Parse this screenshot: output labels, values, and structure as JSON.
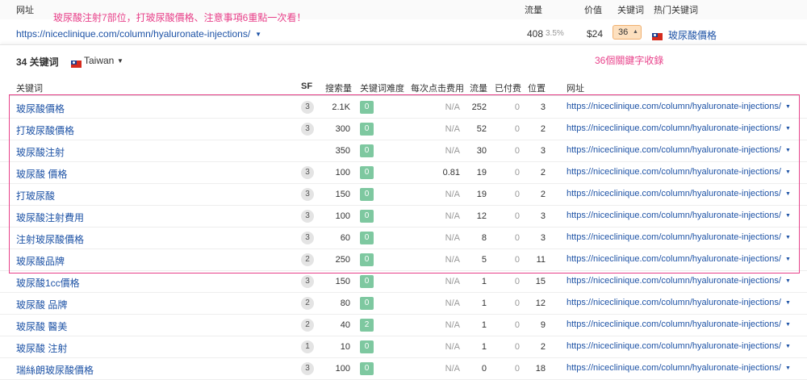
{
  "top_header": {
    "url_label": "网址",
    "traffic_label": "流量",
    "value_label": "价值",
    "keywords_label": "关键词",
    "top_keyword_label": "热门关键词"
  },
  "annotation_top": "玻尿酸注射7部位，打玻尿酸價格、注意事項6重點一次看！",
  "top_row": {
    "url": "https://niceclinique.com/column/hyaluronate-injections/",
    "traffic": "408",
    "traffic_pct": "3.5%",
    "value": "$24",
    "keywords": "36",
    "top_keyword": "玻尿酸價格",
    "top_keyword_flag": "taiwan-flag-icon"
  },
  "panel": {
    "count": "34 关键词",
    "country": "Taiwan",
    "annotation": "36個關鍵字收錄"
  },
  "columns": {
    "keyword": "关键词",
    "sf": "SF",
    "volume": "搜索量",
    "kd": "关键词难度",
    "cpc": "每次点击费用",
    "traffic": "流量",
    "paid": "已付费",
    "position": "位置",
    "url": "网址"
  },
  "colors": {
    "link": "#1e53a6",
    "annotation": "#e8418a",
    "kd_badge": "#7ec8a0",
    "sf_badge": "#e4e4e4",
    "keywords_chip": "#fde0bf"
  },
  "rows": [
    {
      "keyword": "玻尿酸價格",
      "sf": "3",
      "volume": "2.1K",
      "kd": "0",
      "cpc": "N/A",
      "traffic": "252",
      "paid": "0",
      "position": "3",
      "url": "https://niceclinique.com/column/hyaluronate-injections/"
    },
    {
      "keyword": "打玻尿酸價格",
      "sf": "3",
      "volume": "300",
      "kd": "0",
      "cpc": "N/A",
      "traffic": "52",
      "paid": "0",
      "position": "2",
      "url": "https://niceclinique.com/column/hyaluronate-injections/"
    },
    {
      "keyword": "玻尿酸注射",
      "sf": "",
      "volume": "350",
      "kd": "0",
      "cpc": "N/A",
      "traffic": "30",
      "paid": "0",
      "position": "3",
      "url": "https://niceclinique.com/column/hyaluronate-injections/"
    },
    {
      "keyword": "玻尿酸 價格",
      "sf": "3",
      "volume": "100",
      "kd": "0",
      "cpc": "0.81",
      "traffic": "19",
      "paid": "0",
      "position": "2",
      "url": "https://niceclinique.com/column/hyaluronate-injections/"
    },
    {
      "keyword": "打玻尿酸",
      "sf": "3",
      "volume": "150",
      "kd": "0",
      "cpc": "N/A",
      "traffic": "19",
      "paid": "0",
      "position": "2",
      "url": "https://niceclinique.com/column/hyaluronate-injections/"
    },
    {
      "keyword": "玻尿酸注射費用",
      "sf": "3",
      "volume": "100",
      "kd": "0",
      "cpc": "N/A",
      "traffic": "12",
      "paid": "0",
      "position": "3",
      "url": "https://niceclinique.com/column/hyaluronate-injections/"
    },
    {
      "keyword": "注射玻尿酸價格",
      "sf": "3",
      "volume": "60",
      "kd": "0",
      "cpc": "N/A",
      "traffic": "8",
      "paid": "0",
      "position": "3",
      "url": "https://niceclinique.com/column/hyaluronate-injections/"
    },
    {
      "keyword": "玻尿酸品牌",
      "sf": "2",
      "volume": "250",
      "kd": "0",
      "cpc": "N/A",
      "traffic": "5",
      "paid": "0",
      "position": "11",
      "url": "https://niceclinique.com/column/hyaluronate-injections/"
    },
    {
      "keyword": "玻尿酸1cc價格",
      "sf": "3",
      "volume": "150",
      "kd": "0",
      "cpc": "N/A",
      "traffic": "1",
      "paid": "0",
      "position": "15",
      "url": "https://niceclinique.com/column/hyaluronate-injections/"
    },
    {
      "keyword": "玻尿酸 品牌",
      "sf": "2",
      "volume": "80",
      "kd": "0",
      "cpc": "N/A",
      "traffic": "1",
      "paid": "0",
      "position": "12",
      "url": "https://niceclinique.com/column/hyaluronate-injections/"
    },
    {
      "keyword": "玻尿酸 醫美",
      "sf": "2",
      "volume": "40",
      "kd": "2",
      "cpc": "N/A",
      "traffic": "1",
      "paid": "0",
      "position": "9",
      "url": "https://niceclinique.com/column/hyaluronate-injections/"
    },
    {
      "keyword": "玻尿酸 注射",
      "sf": "1",
      "volume": "10",
      "kd": "0",
      "cpc": "N/A",
      "traffic": "1",
      "paid": "0",
      "position": "2",
      "url": "https://niceclinique.com/column/hyaluronate-injections/"
    },
    {
      "keyword": "瑞絲朗玻尿酸價格",
      "sf": "3",
      "volume": "100",
      "kd": "0",
      "cpc": "N/A",
      "traffic": "0",
      "paid": "0",
      "position": "18",
      "url": "https://niceclinique.com/column/hyaluronate-injections/"
    }
  ]
}
